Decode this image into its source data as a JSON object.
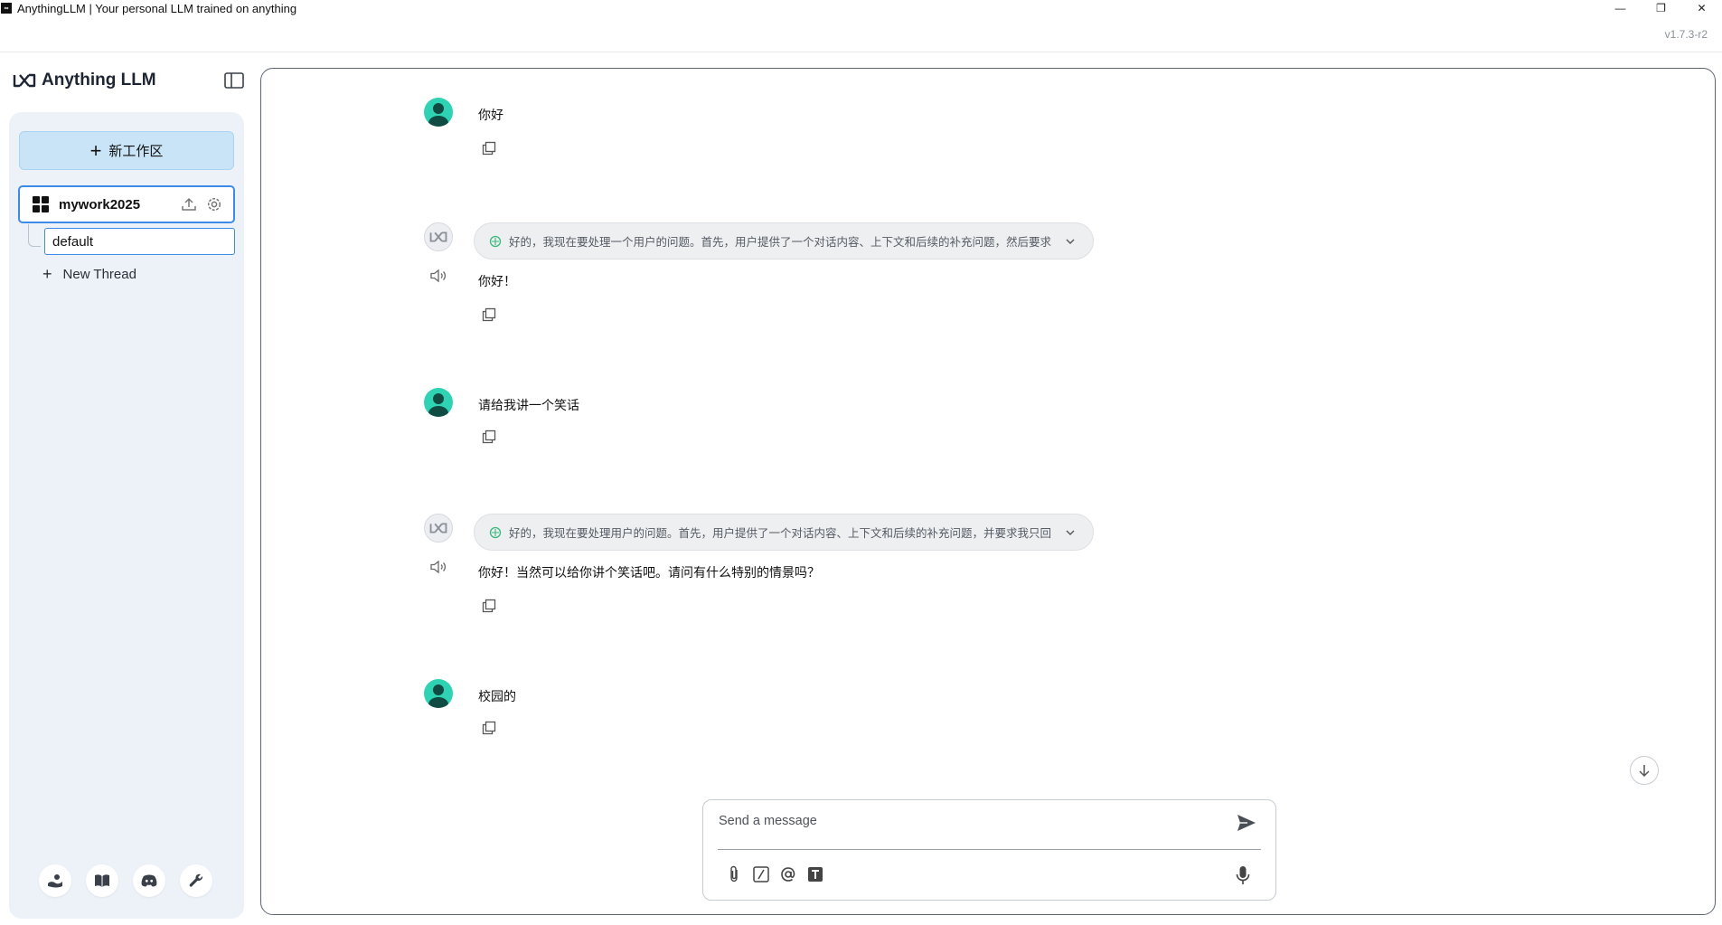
{
  "window": {
    "title": "AnythingLLM | Your personal LLM trained on anything",
    "app_icon_label": "∞",
    "minimize": "—",
    "restore": "❐",
    "close": "✕"
  },
  "version": "v1.7.3-r2",
  "brand": {
    "name": "Anything LLM",
    "accent": "#3c8be6",
    "user_avatar_color": "#2fd3b4"
  },
  "sidebar": {
    "new_workspace_label": "新工作区",
    "workspace": {
      "name": "mywork2025"
    },
    "threads": [
      {
        "label": "default"
      }
    ],
    "new_thread_label": "New Thread",
    "footer_icons": [
      "community-hub-icon",
      "docs-book-icon",
      "discord-icon",
      "settings-wrench-icon"
    ]
  },
  "chat": {
    "messages": [
      {
        "role": "user",
        "text": "你好"
      },
      {
        "role": "assistant",
        "thought": "好的，我现在要处理一个用户的问题。首先，用户提供了一个对话内容、上下文和后续的补充问题，然后要求我...",
        "text": "你好！"
      },
      {
        "role": "user",
        "text": "请给我讲一个笑话"
      },
      {
        "role": "assistant",
        "thought": "好的，我现在要处理用户的问题。首先，用户提供了一个对话内容、上下文和后续的补充问题，并要求我只回复...",
        "text": "你好！当然可以给你讲个笑话吧。请问有什么特别的情景吗？"
      },
      {
        "role": "user",
        "text": "校园的"
      }
    ],
    "composer": {
      "placeholder": "Send a message",
      "tool_icons": [
        "attach-icon",
        "slash-command-icon",
        "at-mention-icon",
        "text-size-icon"
      ]
    }
  }
}
